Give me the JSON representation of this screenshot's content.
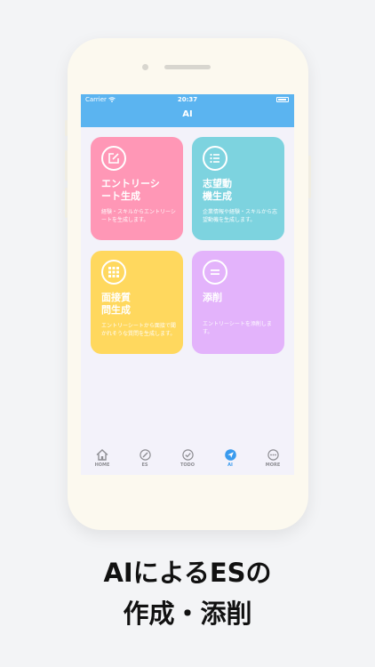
{
  "status_bar": {
    "carrier": "Carrier",
    "time": "20:37"
  },
  "nav": {
    "title": "AI"
  },
  "cards": [
    {
      "title": "エントリーシ\nート生成",
      "description": "経験・スキルからエントリーシートを生成します。",
      "color": "#ff97b6",
      "icon": "edit-icon"
    },
    {
      "title": "志望動\n機生成",
      "description": "企業情報や経験・スキルから志望動機を生成します。",
      "color": "#7dd3df",
      "icon": "list-icon"
    },
    {
      "title": "面接質\n問生成",
      "description": "エントリーシートから面接で聞かれそうな質問を生成します。",
      "color": "#ffd85e",
      "icon": "grid-icon"
    },
    {
      "title": "添削",
      "description": "エントリーシートを添削します。",
      "color": "#e3b3fb",
      "icon": "equals-icon"
    }
  ],
  "tabs": [
    {
      "label": "HOME",
      "icon": "home-icon",
      "active": false
    },
    {
      "label": "ES",
      "icon": "pencil-circle-icon",
      "active": false
    },
    {
      "label": "TODO",
      "icon": "check-circle-icon",
      "active": false
    },
    {
      "label": "AI",
      "icon": "paper-plane-icon",
      "active": true
    },
    {
      "label": "MORE",
      "icon": "more-icon",
      "active": false
    }
  ],
  "caption": {
    "line1": "AIによるESの",
    "line2": "作成・添削"
  }
}
